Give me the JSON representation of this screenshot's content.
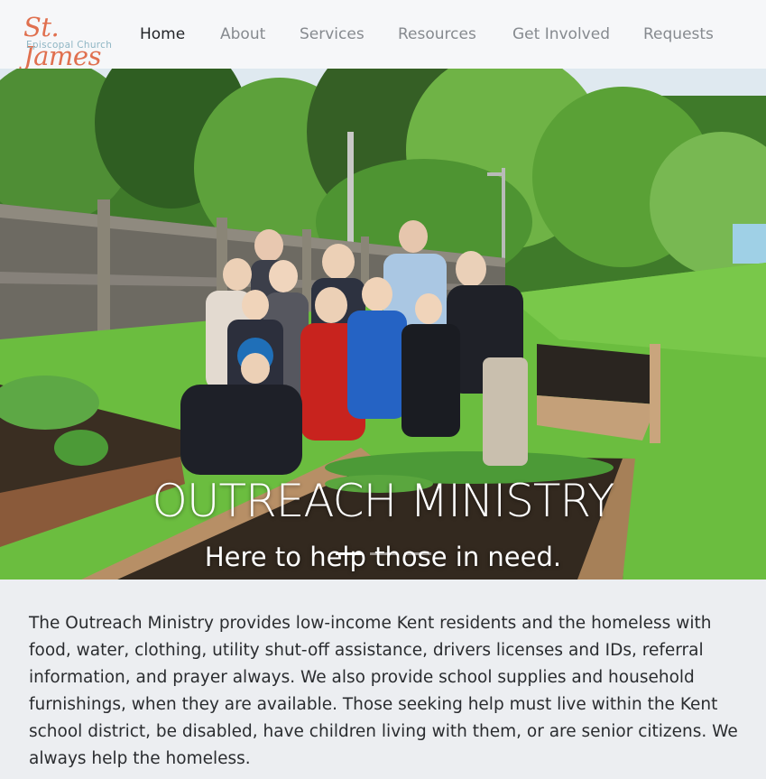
{
  "header": {
    "logo": {
      "title": "St. James",
      "subtitle": "Episcopal Church"
    },
    "nav": [
      {
        "label": "Home",
        "active": true
      },
      {
        "label": "About"
      },
      {
        "label": "Services"
      },
      {
        "label": "Resources"
      },
      {
        "label": "Get Involved"
      },
      {
        "label": "Requests"
      }
    ]
  },
  "hero": {
    "title": "OUTREACH MINISTRY",
    "subtitle": "Here to help those in need.",
    "slides": {
      "count": 3,
      "active_index": 0
    },
    "image_description_icon": "garden-photo"
  },
  "body": {
    "description": "The Outreach Ministry provides low-income Kent residents and the homeless with food, water, clothing, utility shut-off assistance, drivers licenses and IDs, referral information, and prayer always. We also provide school supplies and household furnishings, when they are available. Those seeking help must live within the Kent school district, be disabled, have children living with them, or are senior citizens. We always help the homeless."
  },
  "colors": {
    "logo_title": "#e0704f",
    "logo_subtitle": "#8fb6c4",
    "nav_active": "#222428",
    "nav_inactive": "#868a8f",
    "header_bg": "#f6f7f9",
    "page_bg": "#eceef1"
  }
}
